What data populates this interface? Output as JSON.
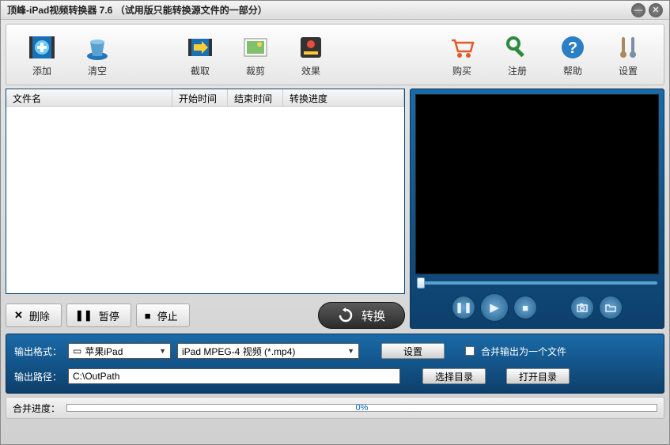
{
  "title": "顶峰-iPad视频转换器 7.6 （试用版只能转换源文件的一部分）",
  "toolbar": {
    "add": "添加",
    "clear": "清空",
    "capture": "截取",
    "crop": "裁剪",
    "effect": "效果",
    "buy": "购买",
    "register": "注册",
    "help": "帮助",
    "settings": "设置"
  },
  "columns": {
    "filename": "文件名",
    "start": "开始时间",
    "end": "结束时间",
    "progress": "转换进度"
  },
  "controls": {
    "delete": "删除",
    "pause": "暂停",
    "stop": "停止",
    "convert": "转换"
  },
  "output": {
    "format_label": "输出格式：",
    "format_device": "苹果iPad",
    "format_codec": "iPad MPEG-4 视频 (*.mp4)",
    "settings_btn": "设置",
    "merge_label": "合并输出为一个文件",
    "path_label": "输出路径：",
    "path_value": "C:\\OutPath",
    "choose_dir": "选择目录",
    "open_dir": "打开目录"
  },
  "footer": {
    "label": "合并进度：",
    "percent": "0%"
  }
}
